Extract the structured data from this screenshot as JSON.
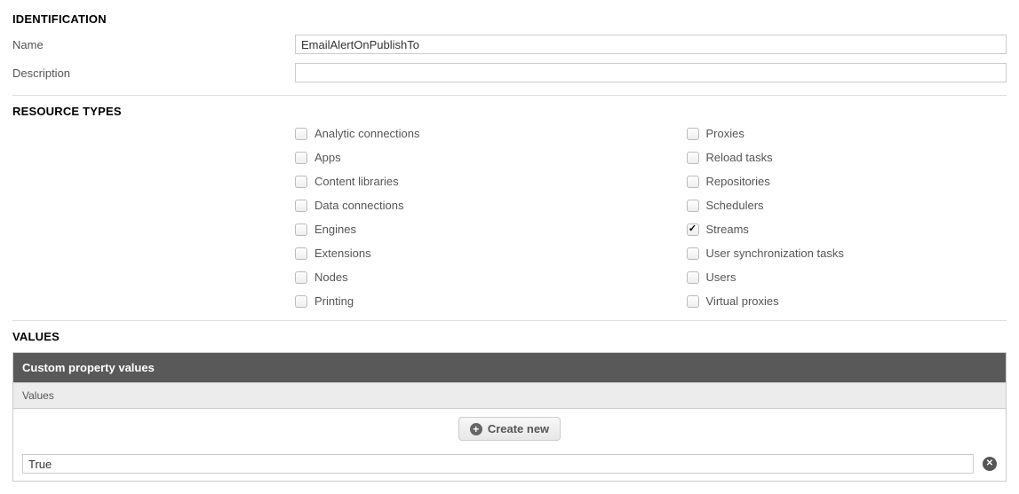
{
  "identification": {
    "heading": "IDENTIFICATION",
    "name_label": "Name",
    "name_value": "EmailAlertOnPublishTo",
    "description_label": "Description",
    "description_value": ""
  },
  "resource_types": {
    "heading": "RESOURCE TYPES",
    "left": [
      {
        "label": "Analytic connections",
        "checked": false
      },
      {
        "label": "Apps",
        "checked": false
      },
      {
        "label": "Content libraries",
        "checked": false
      },
      {
        "label": "Data connections",
        "checked": false
      },
      {
        "label": "Engines",
        "checked": false
      },
      {
        "label": "Extensions",
        "checked": false
      },
      {
        "label": "Nodes",
        "checked": false
      },
      {
        "label": "Printing",
        "checked": false
      }
    ],
    "right": [
      {
        "label": "Proxies",
        "checked": false
      },
      {
        "label": "Reload tasks",
        "checked": false
      },
      {
        "label": "Repositories",
        "checked": false
      },
      {
        "label": "Schedulers",
        "checked": false
      },
      {
        "label": "Streams",
        "checked": true
      },
      {
        "label": "User synchronization tasks",
        "checked": false
      },
      {
        "label": "Users",
        "checked": false
      },
      {
        "label": "Virtual proxies",
        "checked": false
      }
    ]
  },
  "values": {
    "heading": "VALUES",
    "table_header": "Custom property values",
    "column_header": "Values",
    "create_label": "Create new",
    "items": [
      {
        "value": "True"
      }
    ]
  }
}
